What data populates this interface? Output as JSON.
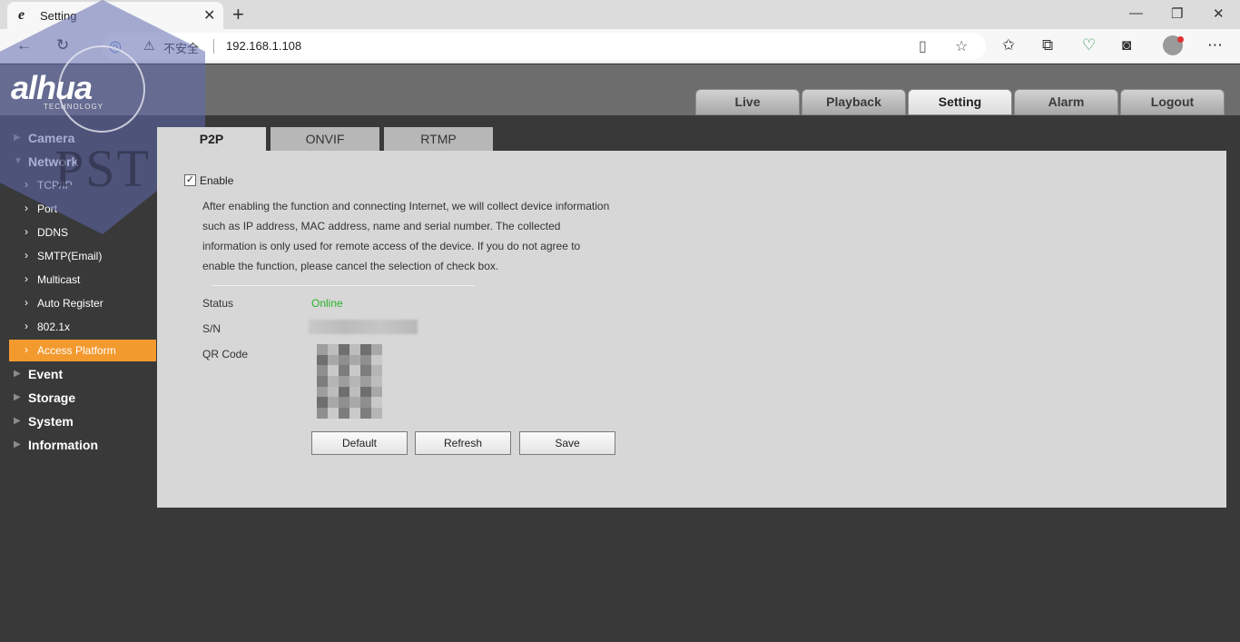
{
  "browser": {
    "tab_title": "Setting",
    "tab_favicon": "e",
    "security_label": "不安全",
    "url": "192.168.1.108"
  },
  "header": {
    "brand": "alhua",
    "brand_sub": "TECHNOLOGY",
    "watermark": "PST",
    "tabs": [
      {
        "label": "Live"
      },
      {
        "label": "Playback"
      },
      {
        "label": "Setting"
      },
      {
        "label": "Alarm"
      },
      {
        "label": "Logout"
      }
    ],
    "active_tab": "Setting"
  },
  "sidebar": {
    "groups": [
      {
        "label": "Camera"
      },
      {
        "label": "Network"
      },
      {
        "label": "Event"
      },
      {
        "label": "Storage"
      },
      {
        "label": "System"
      },
      {
        "label": "Information"
      }
    ],
    "network_items": [
      {
        "label": "TCP/IP"
      },
      {
        "label": "Port"
      },
      {
        "label": "DDNS"
      },
      {
        "label": "SMTP(Email)"
      },
      {
        "label": "Multicast"
      },
      {
        "label": "Auto Register"
      },
      {
        "label": "802.1x"
      },
      {
        "label": "Access Platform"
      }
    ],
    "active_item": "Access Platform",
    "accent_color": "#f39a2f"
  },
  "content": {
    "sub_tabs": [
      {
        "label": "P2P"
      },
      {
        "label": "ONVIF"
      },
      {
        "label": "RTMP"
      }
    ],
    "active_sub_tab": "P2P",
    "enable_label": "Enable",
    "enable_checked": true,
    "description": [
      "After enabling the function and connecting Internet, we will collect device information",
      "such as IP address, MAC address, name and serial number. The collected",
      "information is only used for remote access of the device. If you do not agree to",
      "enable the function, please cancel the selection of check box."
    ],
    "status_label": "Status",
    "status_value": "Online",
    "status_color": "#27b327",
    "sn_label": "S/N",
    "qr_label": "QR Code",
    "buttons": {
      "default": "Default",
      "refresh": "Refresh",
      "save": "Save"
    }
  }
}
